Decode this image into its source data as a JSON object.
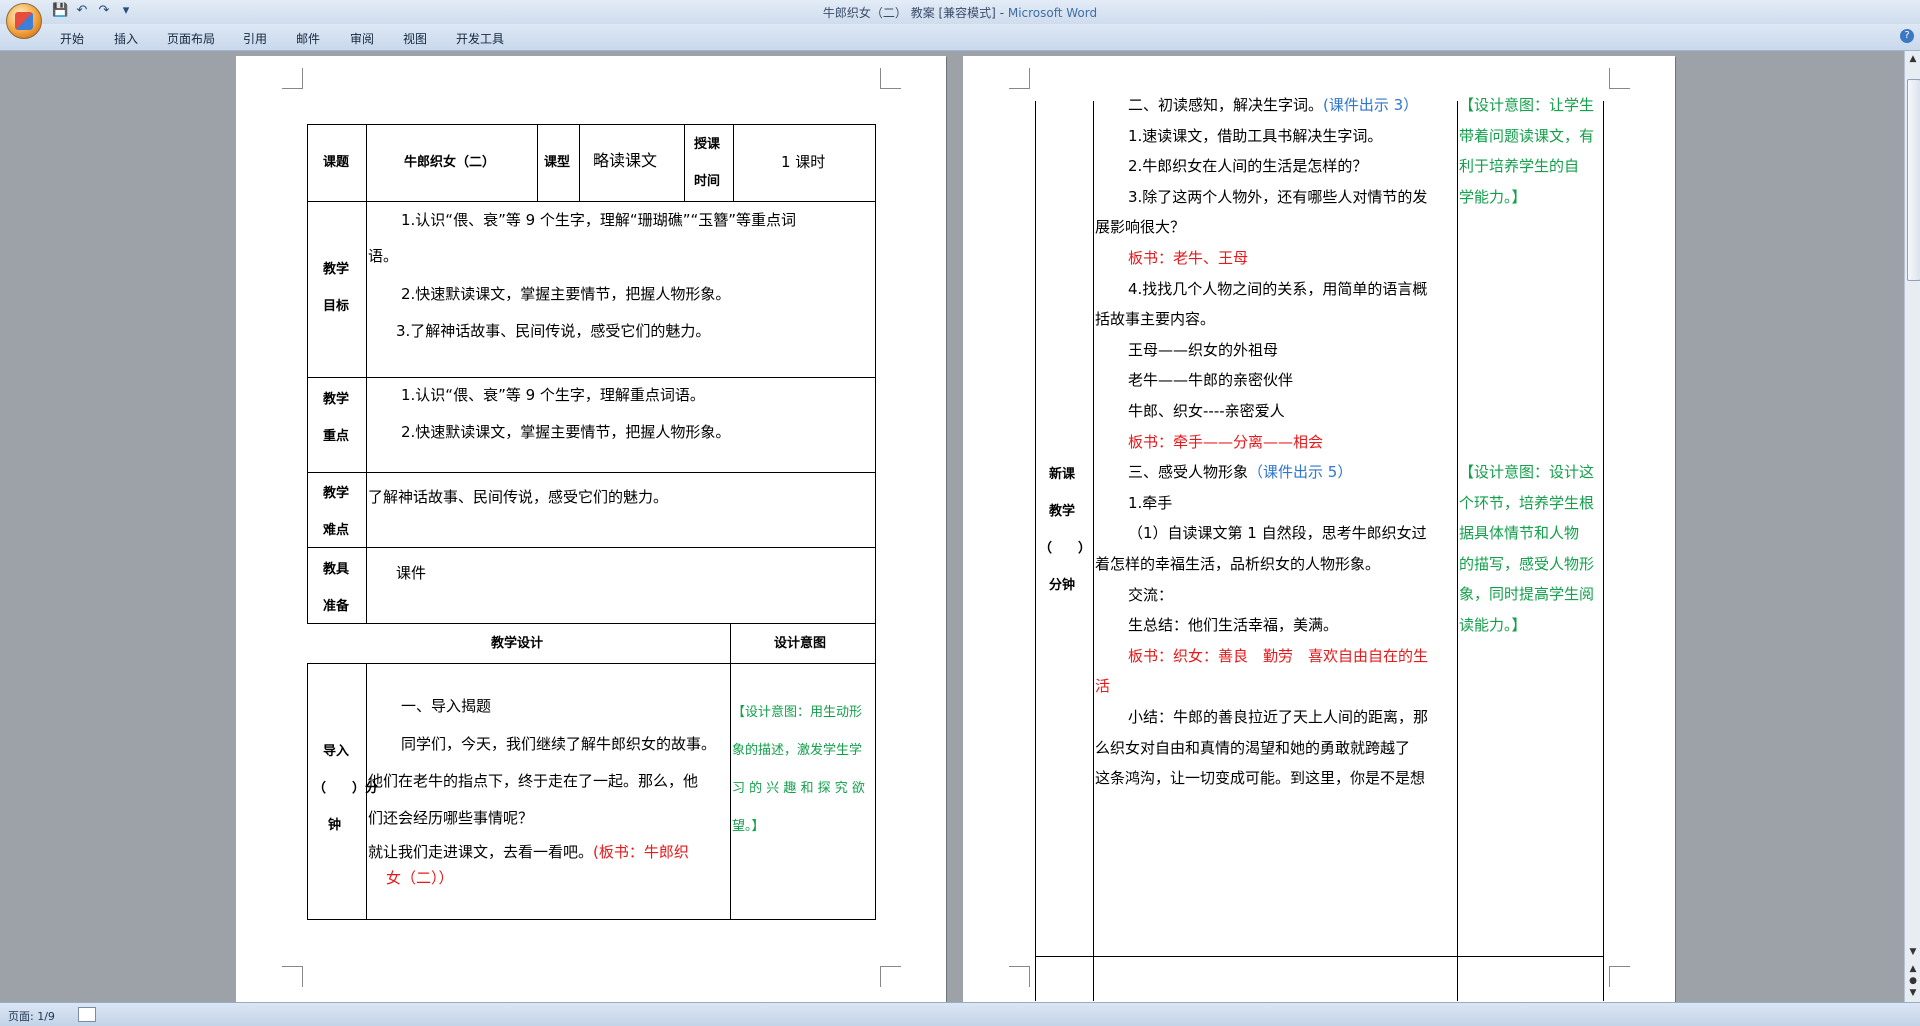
{
  "window": {
    "title": "牛郎织女（二） 教案 [兼容模式]",
    "app": "Microsoft Word",
    "title_separator": " - "
  },
  "ribbon_tabs": [
    "开始",
    "插入",
    "页面布局",
    "引用",
    "邮件",
    "审阅",
    "视图",
    "开发工具"
  ],
  "help_label": "?",
  "status": {
    "page": "页面: 1/9"
  },
  "page1": {
    "header": {
      "topic_label": "课题",
      "topic_value": "牛郎织女（二）",
      "type_label": "课型",
      "type_value": "略读课文",
      "time_label_1": "授课",
      "time_label_2": "时间",
      "time_value": "1 课时"
    },
    "goals": {
      "label_1": "教学",
      "label_2": "目标",
      "line1": "1.认识“偎、衰”等 9 个生字，理解“珊瑚礁”“玉簪”等重点词",
      "line1b": "语。",
      "line2": "2.快速默读课文，掌握主要情节，把握人物形象。",
      "line3": "3.了解神话故事、民间传说，感受它们的魅力。"
    },
    "key": {
      "label_1": "教学",
      "label_2": "重点",
      "line1": "1.认识“偎、衰”等 9 个生字，理解重点词语。",
      "line2": "2.快速默读课文，掌握主要情节，把握人物形象。"
    },
    "difficulty": {
      "label_1": "教学",
      "label_2": "难点",
      "line1": "了解神话故事、民间传说，感受它们的魅力。"
    },
    "prep": {
      "label_1": "教具",
      "label_2": "准备",
      "line1": "课件"
    },
    "design_header": {
      "left": "教学设计",
      "right": "设计意图"
    },
    "intro": {
      "label_1": "导入",
      "label_2": "（　　）分",
      "label_3": "钟",
      "heading": "一、导入揭题",
      "p1": "同学们，今天，我们继续了解牛郎织女的故事。",
      "p2": "他们在老牛的指点下，终于走在了一起。那么，他",
      "p3": "们还会经历哪些事情呢？",
      "p4": "就让我们走进课文，去看一看吧。",
      "board_a": "(板书：牛郎织",
      "board_b": "女（二））",
      "intent_1": "【设计意图：用生动形",
      "intent_2": "象的描述，激发学生学",
      "intent_3": "习 的 兴 趣 和 探 究 欲",
      "intent_4": "望。】"
    }
  },
  "page2": {
    "section_label_1": "新课",
    "section_label_2": "教学",
    "section_label_3": "（　　）",
    "section_label_4": "分钟",
    "lines": [
      {
        "text": "二、初读感知，解决生字词。",
        "extra": "(课件出示 3）",
        "extra_color": "blue"
      },
      {
        "text": "1.速读课文，借助工具书解决生字词。"
      },
      {
        "text": "2.牛郎织女在人间的生活是怎样的？"
      },
      {
        "text": "3.除了这两个人物外，还有哪些人对情节的发"
      },
      {
        "text": "展影响很大？",
        "indent": false
      },
      {
        "text": "板书：老牛、王母",
        "color": "red"
      },
      {
        "text": "4.找找几个人物之间的关系，用简单的语言概"
      },
      {
        "text": "括故事主要内容。",
        "indent": false
      },
      {
        "text": "王母——织女的外祖母"
      },
      {
        "text": "老牛——牛郎的亲密伙伴"
      },
      {
        "text": "牛郎、织女----亲密爱人"
      },
      {
        "text": "板书：牵手——分离——相会",
        "color": "red"
      },
      {
        "text": "三、感受人物形象",
        "extra": "（课件出示 5）",
        "extra_color": "blue"
      },
      {
        "text": "1.牵手"
      },
      {
        "text": "（1）自读课文第 1 自然段，思考牛郎织女过"
      },
      {
        "text": "着怎样的幸福生活，品析织女的人物形象。",
        "indent": false
      },
      {
        "text": "交流："
      },
      {
        "text": " 生总结：他们生活幸福，美满。"
      },
      {
        "text": "板书：织女：善良　勤劳　喜欢自由自在的生",
        "color": "red"
      },
      {
        "text": "活",
        "color": "red",
        "indent": false
      },
      {
        "text": "小结：牛郎的善良拉近了天上人间的距离，那"
      },
      {
        "text": "么织女对自由和真情的渴望和她的勇敢就跨越了",
        "indent": false
      },
      {
        "text": "这条鸿沟，让一切变成可能。到这里，你是不是想",
        "indent": false
      }
    ],
    "intent_a": [
      "【设计意图：让学生",
      "带着问题读课文，有",
      "利于培养学生的自",
      "学能力。】"
    ],
    "intent_b": [
      "【设计意图：设计这",
      "个环节，培养学生根",
      "据具体情节和人物",
      "的描写，感受人物形",
      "象，同时提高学生阅",
      "读能力。】"
    ]
  },
  "colors": {
    "red": "#e8191b",
    "blue": "#2e76d0",
    "green": "#12a04a"
  }
}
